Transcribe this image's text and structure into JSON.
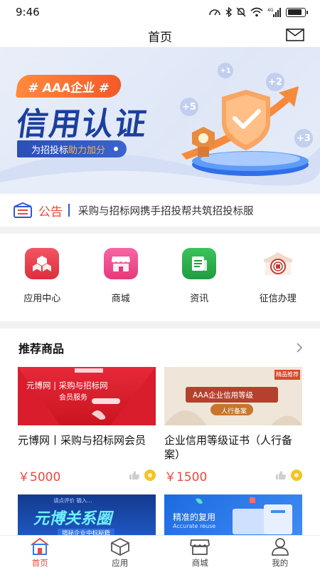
{
  "status_bar": {
    "time": "9:46",
    "battery_level": 0.85,
    "network": "4G"
  },
  "header": {
    "title": "首页",
    "mail_icon": "mail-icon"
  },
  "banner": {
    "tag": "# AAA企业 #",
    "headline": "信用认证",
    "subline_prefix": "为招投标",
    "subline_highlight": "助力加分",
    "bubbles": [
      "+1",
      "+2",
      "+5",
      "+3"
    ]
  },
  "notice": {
    "label": "公告",
    "text": "采购与招标网携手招投帮共筑招投标服"
  },
  "shortcuts": [
    {
      "label": "应用中心",
      "icon": "app-center-icon",
      "color": "#e8404b"
    },
    {
      "label": "商城",
      "icon": "store-icon",
      "color": "#f04c86"
    },
    {
      "label": "资讯",
      "icon": "news-icon",
      "color": "#2fb14d"
    },
    {
      "label": "征信办理",
      "icon": "credit-seal-icon",
      "color": "#c9372c"
    }
  ],
  "recommend": {
    "title": "推荐商品",
    "products": [
      {
        "name": "元博网丨采购与招标网会员",
        "price": "￥5000",
        "image_lines": [
          "元博网 | 采购与招标网",
          "会员服务"
        ]
      },
      {
        "name": "企业信用等级证书（人行备案）",
        "price": "￥1500",
        "image_lines": [
          "AAA企业信用等级",
          "人行备案",
          "精品推荐"
        ]
      },
      {
        "name": "",
        "price": "",
        "image_lines": [
          "元博关系圈",
          "揭秘企业中标秘籍",
          "请点评价 输入..."
        ]
      },
      {
        "name": "",
        "price": "",
        "image_lines": [
          "精准的复用",
          "Accurate reuse"
        ]
      }
    ]
  },
  "tabbar": [
    {
      "label": "首页",
      "icon": "home-icon",
      "active": true
    },
    {
      "label": "应用",
      "icon": "cube-icon",
      "active": false
    },
    {
      "label": "商城",
      "icon": "shop-icon",
      "active": false
    },
    {
      "label": "我的",
      "icon": "user-icon",
      "active": false
    }
  ],
  "colors": {
    "accent": "#e84b3c",
    "brand_blue": "#1c3f9e",
    "price": "#e84b3c"
  }
}
